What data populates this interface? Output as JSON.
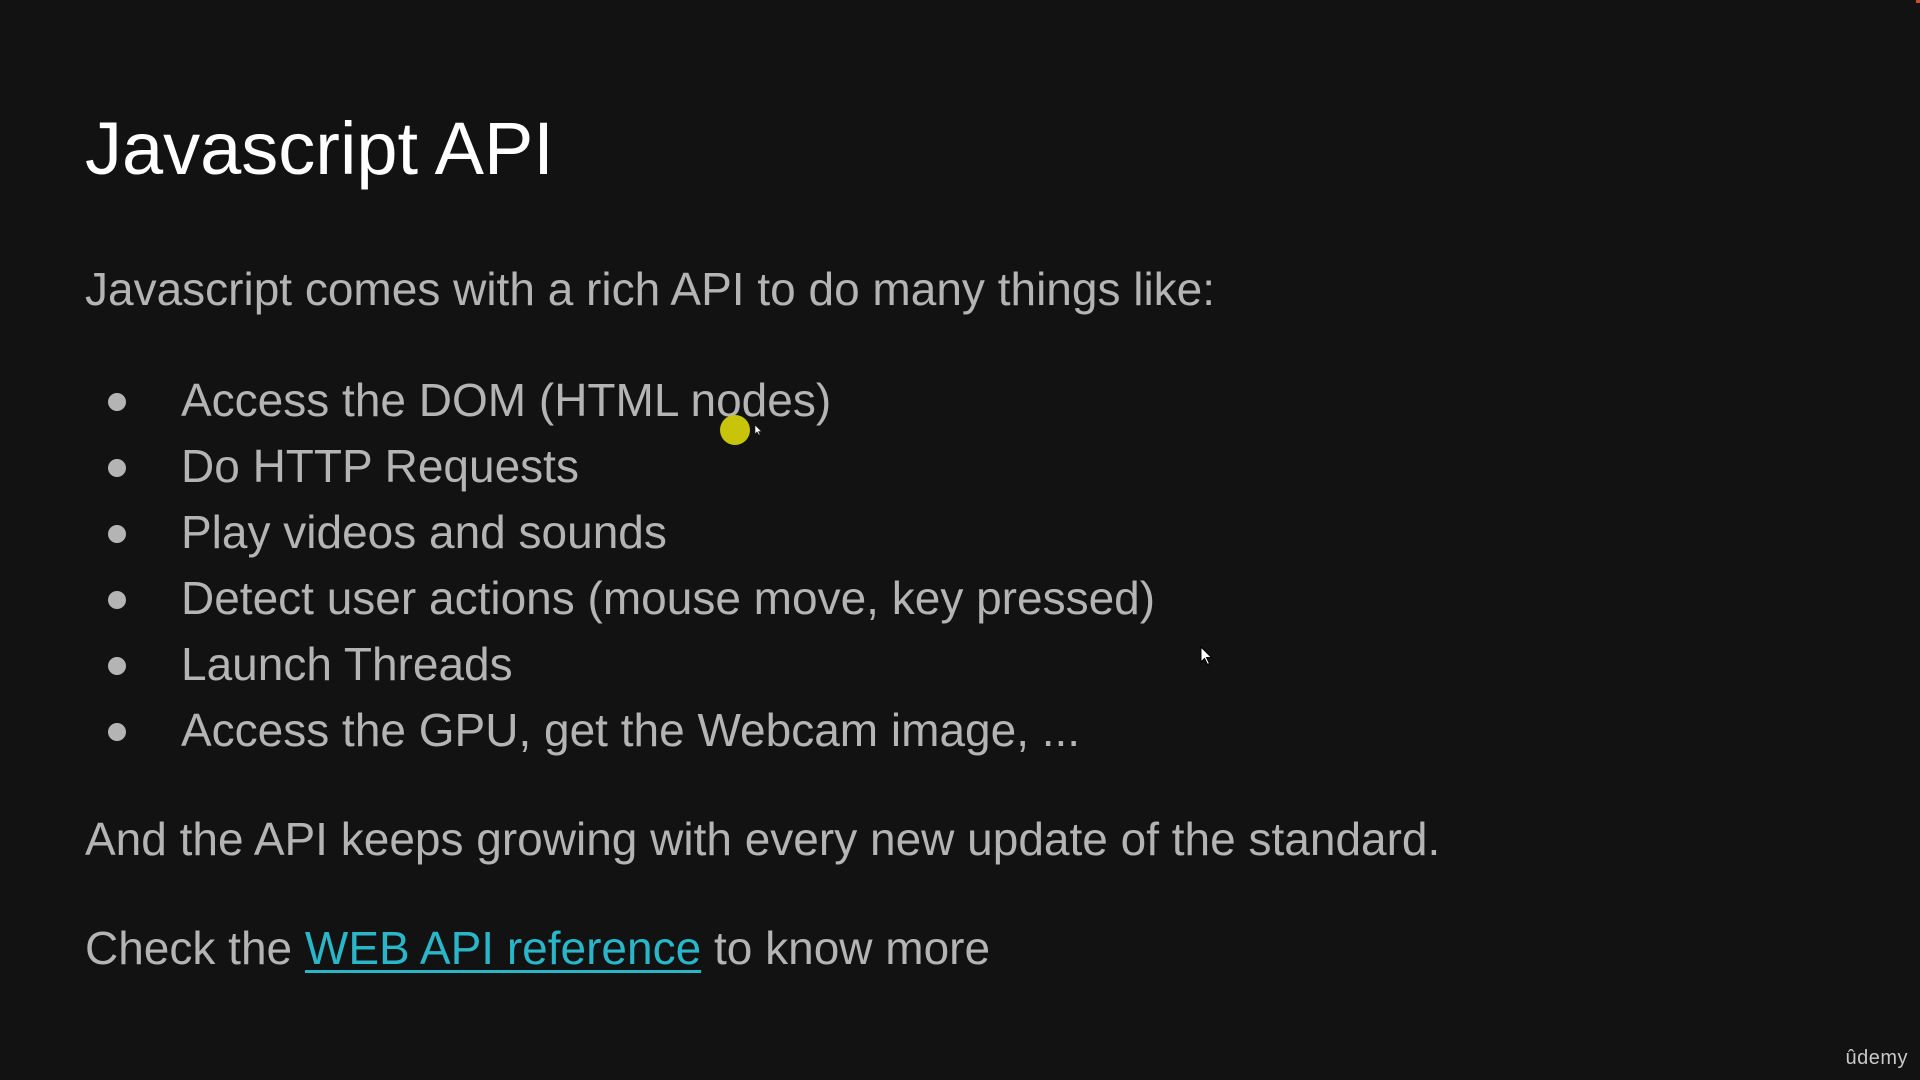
{
  "slide": {
    "title": "Javascript API",
    "intro": "Javascript comes with a rich API to do many things like:",
    "bullets": [
      "Access the DOM (HTML nodes)",
      "Do HTTP Requests",
      "Play videos and sounds",
      "Detect user actions (mouse move, key pressed)",
      "Launch Threads",
      "Access the GPU, get the Webcam image, ..."
    ],
    "outro": "And the API keeps growing with every new update of the standard.",
    "cta": {
      "prefix": "Check the ",
      "link_text": "WEB API reference",
      "suffix": " to know more"
    }
  },
  "watermark": "ûdemy",
  "colors": {
    "background": "#121212",
    "title": "#ffffff",
    "body_text": "#b4b4b4",
    "link": "#29b6c8",
    "pointer_highlight": "#c8c40a"
  },
  "icons": {
    "pointer": "pointer-highlight-icon",
    "cursor": "mouse-cursor-icon"
  }
}
